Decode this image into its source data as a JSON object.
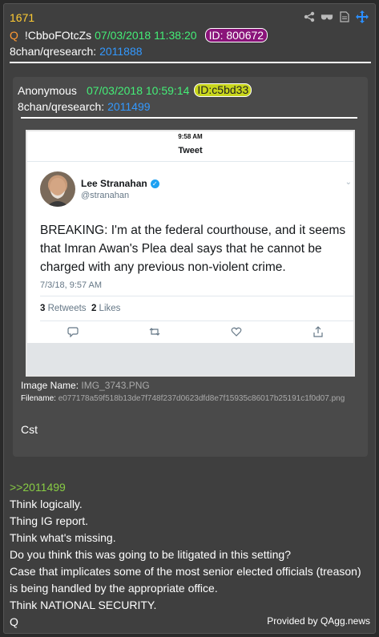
{
  "post": {
    "number": "1671",
    "q_marker": "Q",
    "tripcode": "!CbboFOtcZs",
    "datetime": "07/03/2018 11:38:20",
    "id_badge": "ID: 800672",
    "board_label": "8chan/qresearch:",
    "board_post": "2011888"
  },
  "toolbar": {
    "icons": [
      "share-icon",
      "glasses-icon",
      "document-icon",
      "move-icon"
    ]
  },
  "quoted": {
    "author": "Anonymous",
    "datetime": "07/03/2018 10:59:14",
    "id_badge": "ID:c5bd33",
    "board_label": "8chan/qresearch:",
    "board_post": "2011499",
    "image_name_label": "Image Name:",
    "image_name": "IMG_3743.PNG",
    "filename_label": "Filename:",
    "filename": "e077178a59f518b13de7f748f237d0623dfd8e7f15935c86017b25191c1f0d07.png",
    "body": "Cst",
    "tweet": {
      "status_time": "9:58 AM",
      "header": "Tweet",
      "name": "Lee Stranahan",
      "handle": "@stranahan",
      "text": "BREAKING: I'm at the federal courthouse, and it seems that Imran Awan's Plea deal says that he cannot be charged with any previous non-violent crime.",
      "timestamp": "7/3/18, 9:57 AM",
      "retweets_count": "3",
      "retweets_label": "Retweets",
      "likes_count": "2",
      "likes_label": "Likes"
    }
  },
  "body": {
    "reply_link": ">>2011499",
    "lines": [
      "Think logically.",
      "Thing IG report.",
      "Think what's missing.",
      "Do you think this was going to be litigated in this setting?",
      "Case that implicates some of the most senior elected officials (treason)",
      "is being handled by the appropriate office.",
      "Think NATIONAL SECURITY.",
      "Q"
    ]
  },
  "footer": "Provided by QAgg.news",
  "colors": {
    "card_bg": "#3f3f3f",
    "post_number": "#ffcc33",
    "date": "#44ee77",
    "link": "#3399ff",
    "id_badge_bg": "#8a137a",
    "quoted_id_bg": "#c8d61c",
    "reply_link": "#88cc44"
  }
}
